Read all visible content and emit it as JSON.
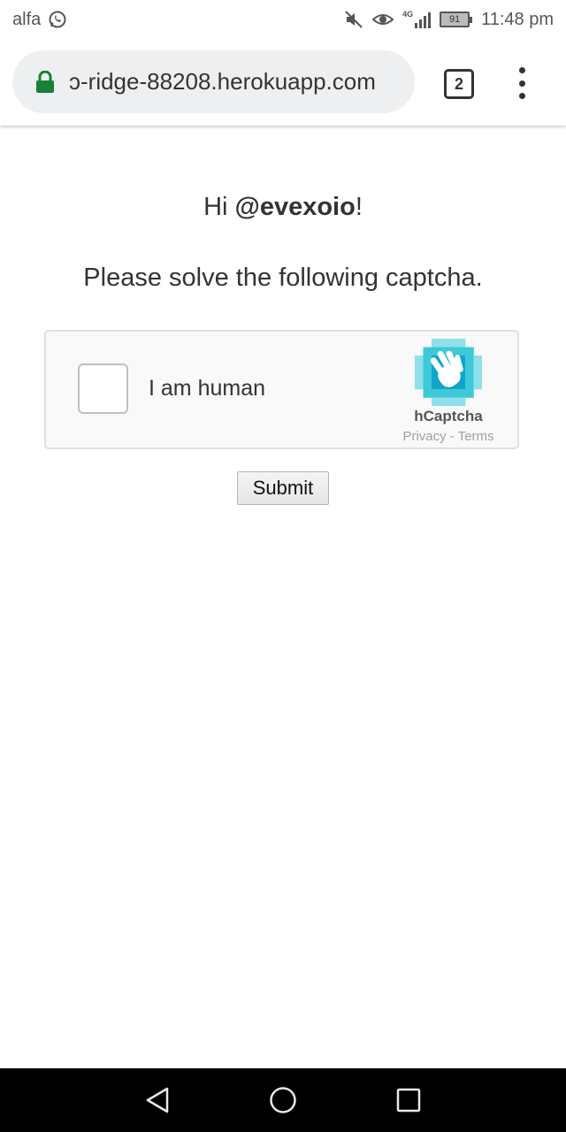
{
  "status_bar": {
    "carrier": "alfa",
    "network": "4G",
    "battery": "91",
    "time": "11:48 pm",
    "icons": [
      "whatsapp-icon",
      "mute-icon",
      "eye-icon",
      "signal-icon",
      "battery-icon"
    ]
  },
  "browser": {
    "url": "ɔ-ridge-88208.herokuapp.com",
    "tab_count": "2",
    "lock_color": "#188038"
  },
  "page": {
    "greeting_prefix": "Hi ",
    "username": "@evexoio",
    "greeting_suffix": "!",
    "instruction": "Please solve the following captcha."
  },
  "captcha": {
    "label": "I am human",
    "brand": "hCaptcha",
    "privacy_link": "Privacy",
    "separator": " - ",
    "terms_link": "Terms",
    "logo_colors": [
      "#0ea5c9",
      "#3fc8d8",
      "#8ee0ea"
    ]
  },
  "form": {
    "submit_label": "Submit"
  },
  "nav_bar": {
    "icons": [
      "back-icon",
      "home-icon",
      "recents-icon"
    ]
  }
}
